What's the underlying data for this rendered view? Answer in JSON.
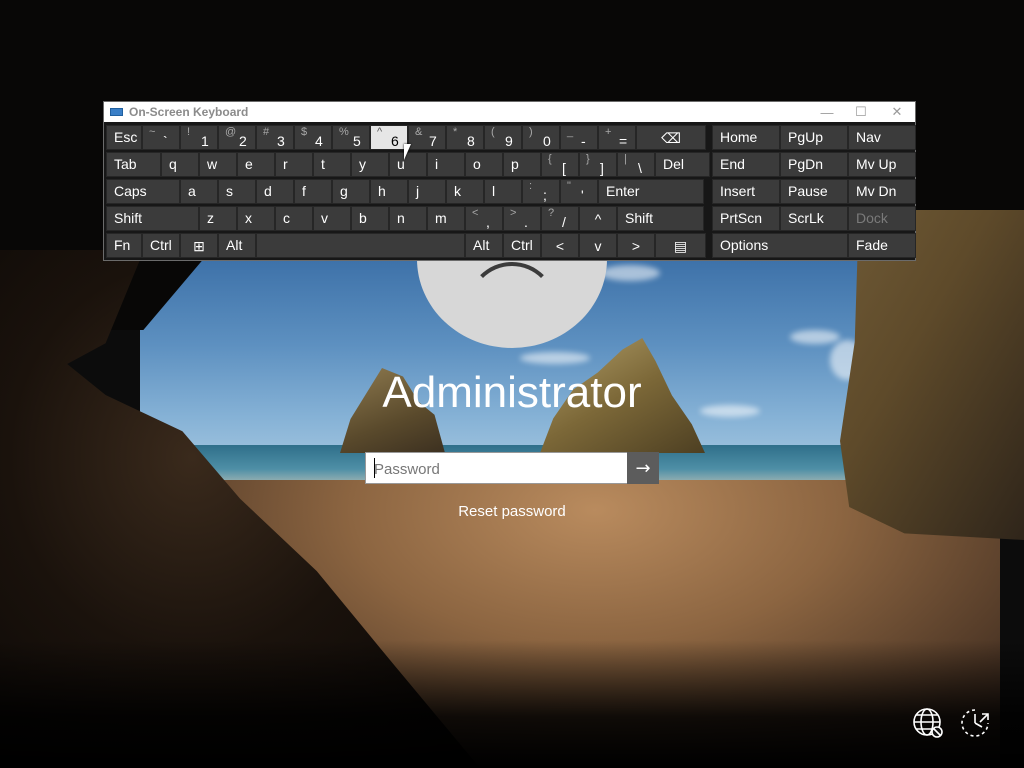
{
  "login": {
    "username": "Administrator",
    "password_placeholder": "Password",
    "submit_icon": "arrow-right-icon",
    "reset_password": "Reset password",
    "corner_icons": [
      "network-icon",
      "ease-of-access-icon"
    ]
  },
  "osk": {
    "title": "On-Screen Keyboard",
    "window_controls": [
      "minimize",
      "maximize",
      "close"
    ],
    "row1": [
      {
        "main": "Esc"
      },
      {
        "shift": "~",
        "main": "`"
      },
      {
        "shift": "!",
        "main": "1"
      },
      {
        "shift": "@",
        "main": "2"
      },
      {
        "shift": "#",
        "main": "3"
      },
      {
        "shift": "$",
        "main": "4"
      },
      {
        "shift": "%",
        "main": "5"
      },
      {
        "shift": "^",
        "main": "6"
      },
      {
        "shift": "&",
        "main": "7"
      },
      {
        "shift": "*",
        "main": "8"
      },
      {
        "shift": "(",
        "main": "9"
      },
      {
        "shift": ")",
        "main": "0"
      },
      {
        "shift": "_",
        "main": "-"
      },
      {
        "shift": "+",
        "main": "="
      },
      {
        "main": "⌫"
      },
      {
        "main": "Home"
      },
      {
        "main": "PgUp"
      },
      {
        "main": "Nav"
      }
    ],
    "row2": [
      {
        "main": "Tab"
      },
      {
        "main": "q"
      },
      {
        "main": "w"
      },
      {
        "main": "e"
      },
      {
        "main": "r"
      },
      {
        "main": "t"
      },
      {
        "main": "y"
      },
      {
        "main": "u"
      },
      {
        "main": "i"
      },
      {
        "main": "o"
      },
      {
        "main": "p"
      },
      {
        "shift": "{",
        "main": "["
      },
      {
        "shift": "}",
        "main": "]"
      },
      {
        "shift": "|",
        "main": "\\"
      },
      {
        "main": "Del"
      },
      {
        "main": "End"
      },
      {
        "main": "PgDn"
      },
      {
        "main": "Mv Up"
      }
    ],
    "row3": [
      {
        "main": "Caps"
      },
      {
        "main": "a"
      },
      {
        "main": "s"
      },
      {
        "main": "d"
      },
      {
        "main": "f"
      },
      {
        "main": "g"
      },
      {
        "main": "h"
      },
      {
        "main": "j"
      },
      {
        "main": "k"
      },
      {
        "main": "l"
      },
      {
        "shift": ":",
        "main": ";"
      },
      {
        "shift": "\"",
        "main": "'"
      },
      {
        "main": "Enter"
      },
      {
        "main": "Insert"
      },
      {
        "main": "Pause"
      },
      {
        "main": "Mv Dn"
      }
    ],
    "row4": [
      {
        "main": "Shift"
      },
      {
        "main": "z"
      },
      {
        "main": "x"
      },
      {
        "main": "c"
      },
      {
        "main": "v"
      },
      {
        "main": "b"
      },
      {
        "main": "n"
      },
      {
        "main": "m"
      },
      {
        "shift": "<",
        "main": ","
      },
      {
        "shift": ">",
        "main": "."
      },
      {
        "shift": "?",
        "main": "/"
      },
      {
        "main": "^"
      },
      {
        "main": "Shift"
      },
      {
        "main": "PrtScn"
      },
      {
        "main": "ScrLk"
      },
      {
        "main": "Dock"
      }
    ],
    "row5": [
      {
        "main": "Fn"
      },
      {
        "main": "Ctrl"
      },
      {
        "main": "⊞"
      },
      {
        "main": "Alt"
      },
      {
        "main": ""
      },
      {
        "main": "Alt"
      },
      {
        "main": "Ctrl"
      },
      {
        "main": "<"
      },
      {
        "main": "v"
      },
      {
        "main": ">"
      },
      {
        "main": "▤"
      },
      {
        "main": "Options"
      },
      {
        "main": "Fade"
      }
    ],
    "highlighted_key": "6",
    "disabled_keys": [
      "Dock"
    ]
  }
}
